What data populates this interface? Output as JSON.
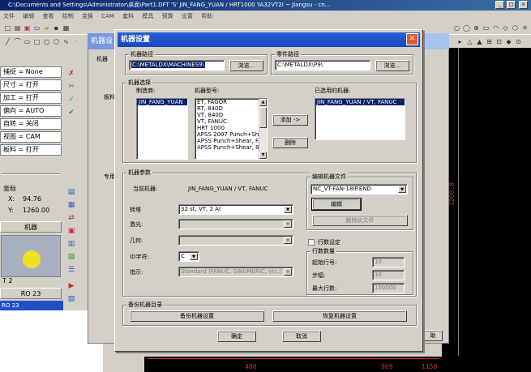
{
  "app": {
    "title": "C:\\Documents and Settings\\Administrator\\桌面\\Part1.DFT  'S'  JIN_FANG_YUAN / HRT1000    YA32VT2I   ~ Jiangsu - cn...",
    "menu": [
      "文件",
      "编辑",
      "查看",
      "绘制",
      "变换",
      "CAM",
      "套料",
      "模具",
      "预算",
      "设置",
      "帮助"
    ]
  },
  "left_panel": {
    "rows": [
      {
        "label": "捕捉",
        "value": "None"
      },
      {
        "label": "尺寸",
        "value": "打开"
      },
      {
        "label": "加工",
        "value": "打开"
      },
      {
        "label": "偏向",
        "value": "AUTO"
      },
      {
        "label": "自转",
        "value": "关闭"
      },
      {
        "label": "视图",
        "value": "CAM"
      },
      {
        "label": "板料",
        "value": "打开"
      }
    ],
    "coord_title": "坐标",
    "x_label": "X:",
    "x_value": "94.76",
    "y_label": "Y:",
    "y_value": "1260.00",
    "machine_title": "机器",
    "tool_label": "T 2",
    "tool_name": "RO 23",
    "status": "RO 23",
    "tool_color": "#f0e020"
  },
  "behind": {
    "title": "机器设",
    "label1": "机器",
    "label2": "板料",
    "label3": "专用",
    "button": "助"
  },
  "dialog": {
    "title": "机器设置",
    "machine_path": {
      "legend": "机器路径",
      "value": "C:\\METALDX\\MACHINES9\\",
      "browse": "浏览..."
    },
    "part_path": {
      "legend": "零件路径",
      "value": "C:\\METALDX\\P9\\",
      "browse": "浏览..."
    },
    "machine_select": {
      "legend": "机器选择",
      "maker_label": "制造商:",
      "makers": [
        "JIN_FANG_YUAN"
      ],
      "model_label": "机器型号:",
      "models": [
        "ET, FAGOR",
        "RT, 840D",
        "VT, 840D",
        "VT, FANUC",
        "HRT 1000",
        "APSS 2007 Punch+She",
        "APSS Punch+Shear, FA",
        "APSS Punch+Shear, 84"
      ],
      "add_button": "添加 ->",
      "delete_button": "删除",
      "selected_label": "已选用的机器:",
      "selected": [
        "JIN_FANG_YUAN / VT, FANUC"
      ]
    },
    "machine_params": {
      "legend": "机器参数",
      "current_label": "当前机器:",
      "current_value": "JIN_FANG_YUAN / VT, FANUC",
      "turret_label": "转塔",
      "turret_value": "32 st, VT, 2 AI",
      "laser_label": "激光:",
      "laser_value": "",
      "geometry_label": "几何:",
      "geometry_value": "",
      "id_label": "ID字符:",
      "id_value": "C",
      "indicator_label": "指示:",
      "indicator_value": "Standard (FANUC, SINUMERIC, etc.)"
    },
    "edit_file": {
      "legend": "编辑机器文件",
      "file_value": "NC_VT-FAN-18IP.END",
      "edit_button": "编辑",
      "delete_file_button": "删除此文件"
    },
    "line_numbers": {
      "checkbox_label": "行数设定",
      "legend": "行数数量",
      "start_label": "起始行号:",
      "start_value": "10",
      "step_label": "步幅:",
      "step_value": "10",
      "max_label": "最大行数:",
      "max_value": "100000"
    },
    "backup": {
      "legend": "备份机器目录",
      "backup_button": "备份机器设置",
      "restore_button": "恢复机器设置"
    },
    "ok_button": "确定",
    "cancel_button": "取消"
  },
  "canvas": {
    "dim_400": "400",
    "dim_969": "969",
    "dim_1150": "1150",
    "dim_1200": "1200.0"
  }
}
